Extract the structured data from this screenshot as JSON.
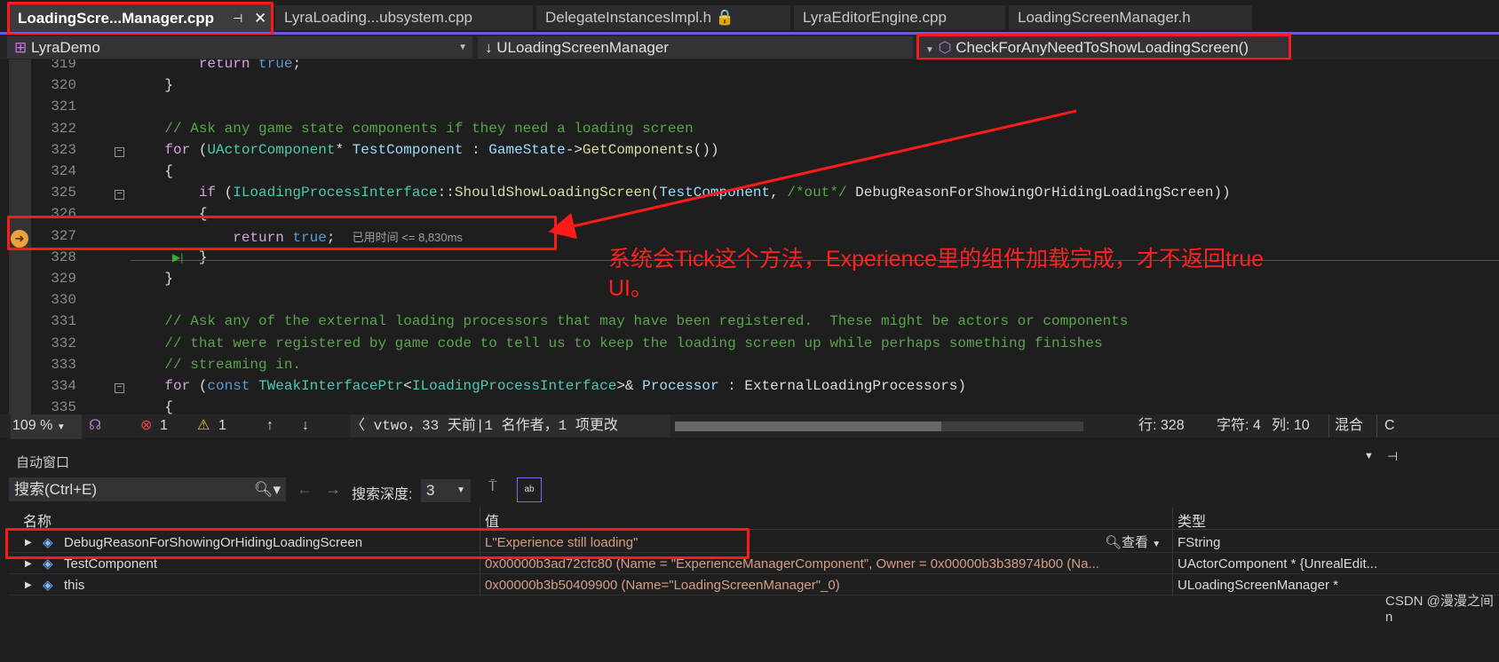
{
  "tabs": [
    {
      "label": "LoadingScre...Manager.cpp",
      "active": true
    },
    {
      "label": "LyraLoading...ubsystem.cpp"
    },
    {
      "label": "DelegateInstancesImpl.h 🔒"
    },
    {
      "label": "LyraEditorEngine.cpp"
    },
    {
      "label": "LoadingScreenManager.h"
    }
  ],
  "nav": {
    "project": "LyraDemo",
    "class": "↓ ULoadingScreenManager",
    "method": "CheckForAnyNeedToShowLoadingScreen()"
  },
  "code": [
    {
      "n": "319",
      "tokens": [
        [
          "        ",
          ""
        ],
        [
          "return",
          "kw2"
        ],
        [
          " ",
          ""
        ],
        [
          "true",
          "kw"
        ],
        [
          ";",
          ""
        ]
      ]
    },
    {
      "n": "320",
      "tokens": [
        [
          "    }",
          ""
        ]
      ]
    },
    {
      "n": "321",
      "tokens": []
    },
    {
      "n": "322",
      "tokens": [
        [
          "    // Ask any game state components if they need a loading screen",
          "cm"
        ]
      ]
    },
    {
      "n": "323",
      "fold": true,
      "tokens": [
        [
          "    ",
          ""
        ],
        [
          "for",
          "kw2"
        ],
        [
          " (",
          ""
        ],
        [
          "UActorComponent",
          "ty"
        ],
        [
          "* ",
          ""
        ],
        [
          "TestComponent",
          "var"
        ],
        [
          " : ",
          ""
        ],
        [
          "GameState",
          "var"
        ],
        [
          "->",
          ""
        ],
        [
          "GetComponents",
          "fn"
        ],
        [
          "())",
          ""
        ]
      ]
    },
    {
      "n": "324",
      "tokens": [
        [
          "    {",
          ""
        ]
      ]
    },
    {
      "n": "325",
      "fold": true,
      "tokens": [
        [
          "        ",
          ""
        ],
        [
          "if",
          "kw2"
        ],
        [
          " (",
          ""
        ],
        [
          "ILoadingProcessInterface",
          "ty"
        ],
        [
          "::",
          ""
        ],
        [
          "ShouldShowLoadingScreen",
          "fn"
        ],
        [
          "(",
          ""
        ],
        [
          "TestComponent",
          "var"
        ],
        [
          ", ",
          ""
        ],
        [
          "/*out*/",
          "cm"
        ],
        [
          " DebugReasonForShowingOrHidingLoadingScreen))",
          ""
        ]
      ]
    },
    {
      "n": "326",
      "tokens": [
        [
          "        {",
          ""
        ]
      ]
    },
    {
      "n": "327",
      "tokens": [
        [
          "            ",
          ""
        ],
        [
          "return",
          "kw2"
        ],
        [
          " ",
          ""
        ],
        [
          "true",
          "kw"
        ],
        [
          ";  ",
          ""
        ]
      ],
      "hint": "已用时间 <= 8,830ms"
    },
    {
      "n": "328",
      "tokens": [
        [
          "        }",
          ""
        ]
      ]
    },
    {
      "n": "329",
      "tokens": [
        [
          "    }",
          ""
        ]
      ]
    },
    {
      "n": "330",
      "tokens": []
    },
    {
      "n": "331",
      "tokens": [
        [
          "    // Ask any of the external loading processors that may have been registered.  These might be actors or components",
          "cm"
        ]
      ]
    },
    {
      "n": "332",
      "tokens": [
        [
          "    // that were registered by game code to tell us to keep the loading screen up while perhaps something finishes",
          "cm"
        ]
      ]
    },
    {
      "n": "333",
      "tokens": [
        [
          "    // streaming in.",
          "cm"
        ]
      ]
    },
    {
      "n": "334",
      "fold": true,
      "tokens": [
        [
          "    ",
          ""
        ],
        [
          "for",
          "kw2"
        ],
        [
          " (",
          ""
        ],
        [
          "const",
          "kw"
        ],
        [
          " ",
          ""
        ],
        [
          "TWeakInterfacePtr",
          "ty"
        ],
        [
          "<",
          ""
        ],
        [
          "ILoadingProcessInterface",
          "ty"
        ],
        [
          ">& ",
          ""
        ],
        [
          "Processor",
          "var"
        ],
        [
          " : ExternalLoadingProcessors)",
          ""
        ]
      ]
    },
    {
      "n": "335",
      "tokens": [
        [
          "    {",
          ""
        ]
      ]
    }
  ],
  "status": {
    "zoom": "109 %",
    "errors": "1",
    "warnings": "1",
    "git": "〈 vtwo，33 天前|1 名作者，1 项更改",
    "line": "行: 328",
    "char": "字符: 4",
    "col": "列: 10",
    "mode": "混合",
    "extra": "C"
  },
  "auto": {
    "title": "自动窗口",
    "search_placeholder": "搜索(Ctrl+E)",
    "depth_label": "搜索深度:",
    "depth": "3",
    "col_name": "名称",
    "col_value": "值",
    "col_type": "类型",
    "view_label": "查看",
    "rows": [
      {
        "name": "DebugReasonForShowingOrHidingLoadingScreen",
        "value": "L\"Experience still loading\"",
        "type": "FString"
      },
      {
        "name": "TestComponent",
        "value": "0x00000b3ad72cfc80 (Name = \"ExperienceManagerComponent\", Owner = 0x00000b3b38974b00 (Na...",
        "type": "UActorComponent * {UnrealEdit..."
      },
      {
        "name": "this",
        "value": "0x00000b3b50409900 (Name=\"LoadingScreenManager\"_0)",
        "type": "ULoadingScreenManager *"
      }
    ]
  },
  "annotation": {
    "line1": "系统会Tick这个方法，Experience里的组件加载完成，才不返回true",
    "line2": "UI。",
    "color": "#ff2020"
  },
  "watermark": "CSDN @漫漫之间n"
}
